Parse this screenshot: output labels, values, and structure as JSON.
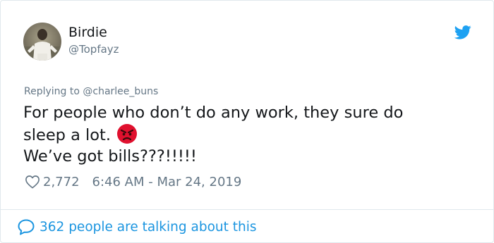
{
  "tweet": {
    "author": {
      "display_name": "Birdie",
      "handle": "@Topfayz"
    },
    "reply_to": "Replying to @charlee_buns",
    "text_lines": [
      "For people who don’t do any work, they sure do",
      "sleep a lot.",
      "We’ve got bills???!!!!!"
    ],
    "emoji": "angry-face-emoji",
    "likes": "2,772",
    "timestamp": "6:46 AM - Mar 24, 2019",
    "conversation": "362 people are talking about this"
  },
  "icons": {
    "brand": "twitter-bird-icon",
    "like": "heart-icon",
    "reply": "speech-bubble-icon"
  },
  "colors": {
    "brand_blue": "#1da1f2",
    "link_blue": "#1b95e0",
    "muted_text": "#657786",
    "main_text": "#14171a",
    "border": "#e1e8ed",
    "emoji_red": "#e0102e"
  }
}
